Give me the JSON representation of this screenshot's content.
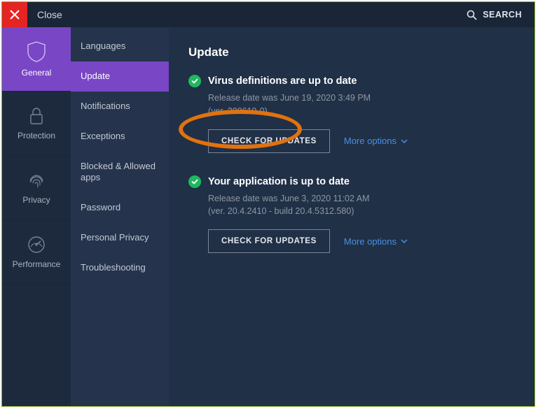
{
  "topbar": {
    "close_label": "Close",
    "search_label": "SEARCH"
  },
  "rail": {
    "items": [
      {
        "label": "General"
      },
      {
        "label": "Protection"
      },
      {
        "label": "Privacy"
      },
      {
        "label": "Performance"
      }
    ]
  },
  "subnav": {
    "items": [
      {
        "label": "Languages"
      },
      {
        "label": "Update"
      },
      {
        "label": "Notifications"
      },
      {
        "label": "Exceptions"
      },
      {
        "label": "Blocked & Allowed apps"
      },
      {
        "label": "Password"
      },
      {
        "label": "Personal Privacy"
      },
      {
        "label": "Troubleshooting"
      }
    ]
  },
  "main": {
    "title": "Update",
    "sections": [
      {
        "title": "Virus definitions are up to date",
        "release_line1": "Release date was June 19, 2020 3:49 PM",
        "release_line2": "(ver. 200619-0)",
        "check_btn": "CHECK FOR UPDATES",
        "more": "More options"
      },
      {
        "title": "Your application is up to date",
        "release_line1": "Release date was June 3, 2020 11:02 AM",
        "release_line2": "(ver. 20.4.2410 - build 20.4.5312.580)",
        "check_btn": "CHECK FOR UPDATES",
        "more": "More options"
      }
    ]
  }
}
